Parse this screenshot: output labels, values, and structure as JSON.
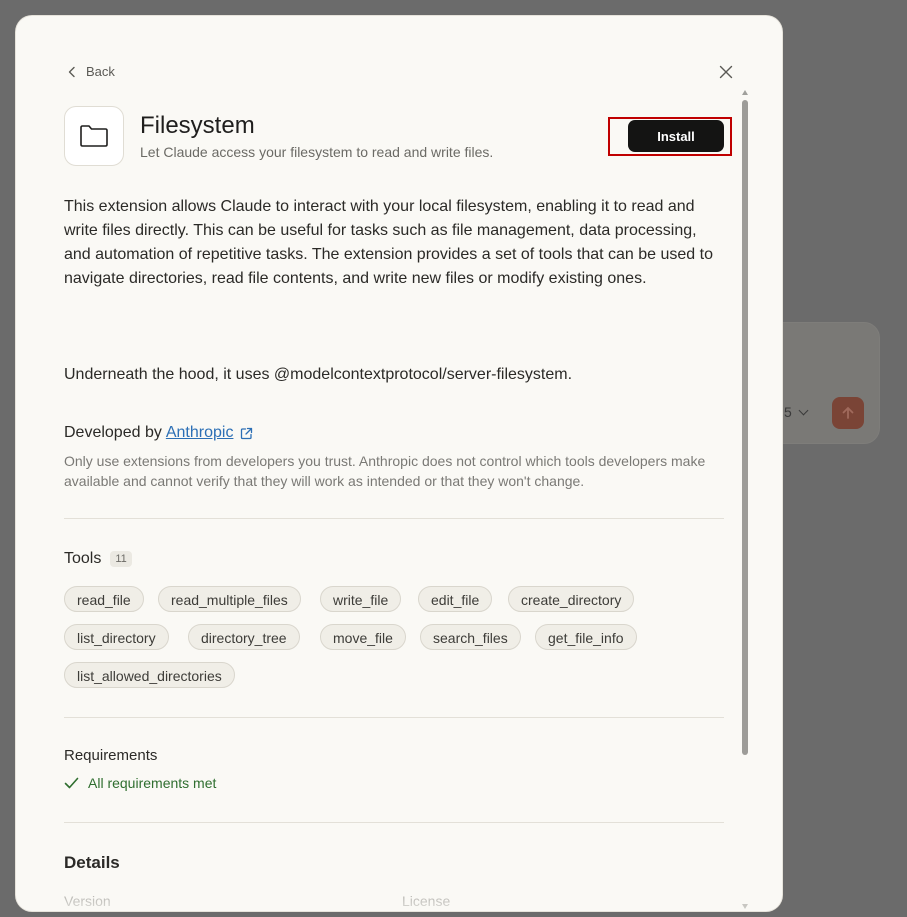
{
  "background": {
    "model_label": "5",
    "send_color": "#7a4436"
  },
  "header": {
    "back_label": "Back"
  },
  "extension": {
    "name": "Filesystem",
    "tagline": "Let Claude access your filesystem to read and write files.",
    "install_label": "Install",
    "description": "This extension allows Claude to interact with your local filesystem, enabling it to read and write files directly. This can be useful for tasks such as file management, data processing, and automation of repetitive tasks. The extension provides a set of tools that can be used to navigate directories, read file contents, and write new files or modify existing ones.",
    "underneath": "Underneath the hood, it uses @modelcontextprotocol/server-filesystem.",
    "developed_by_prefix": "Developed by",
    "developer": "Anthropic",
    "trust_notice": "Only use extensions from developers you trust. Anthropic does not control which tools developers make available and cannot verify that they will work as intended or that they won't change."
  },
  "tools": {
    "heading": "Tools",
    "count": "11",
    "items": [
      "read_file",
      "read_multiple_files",
      "write_file",
      "edit_file",
      "create_directory",
      "list_directory",
      "directory_tree",
      "move_file",
      "search_files",
      "get_file_info",
      "list_allowed_directories"
    ]
  },
  "requirements": {
    "heading": "Requirements",
    "status": "All requirements met"
  },
  "details": {
    "heading": "Details",
    "version_label": "Version",
    "license_label": "License"
  },
  "colors": {
    "accent_link": "#2c6fb5",
    "success": "#2f6e2f",
    "install_bg": "#141413",
    "highlight": "#c00000"
  }
}
